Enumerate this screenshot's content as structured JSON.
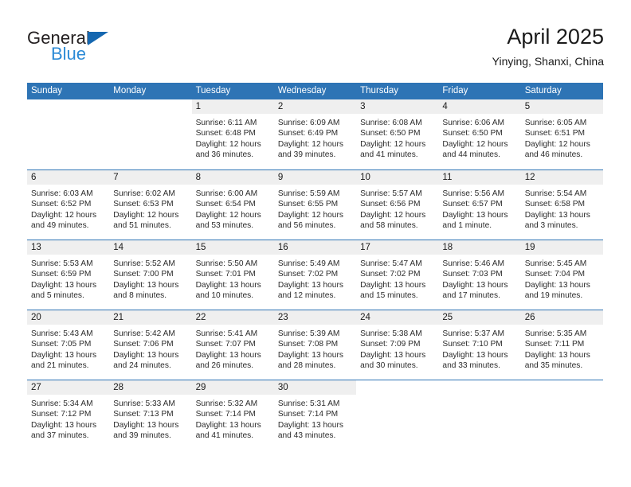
{
  "brand": {
    "name_part1": "General",
    "name_part2": "Blue",
    "color_dark": "#231f20",
    "color_blue": "#2b8ad6",
    "triangle_color": "#1567b0"
  },
  "header": {
    "title": "April 2025",
    "subtitle": "Yinying, Shanxi, China"
  },
  "theme": {
    "header_blue": "#2e74b5",
    "day_band_gray": "#efefef",
    "text_color": "#1a1a1a"
  },
  "weekdays": [
    "Sunday",
    "Monday",
    "Tuesday",
    "Wednesday",
    "Thursday",
    "Friday",
    "Saturday"
  ],
  "weeks": [
    [
      {
        "day": "",
        "sunrise": "",
        "sunset": "",
        "daylight_line1": "",
        "daylight_line2": ""
      },
      {
        "day": "",
        "sunrise": "",
        "sunset": "",
        "daylight_line1": "",
        "daylight_line2": ""
      },
      {
        "day": "1",
        "sunrise": "Sunrise: 6:11 AM",
        "sunset": "Sunset: 6:48 PM",
        "daylight_line1": "Daylight: 12 hours",
        "daylight_line2": "and 36 minutes."
      },
      {
        "day": "2",
        "sunrise": "Sunrise: 6:09 AM",
        "sunset": "Sunset: 6:49 PM",
        "daylight_line1": "Daylight: 12 hours",
        "daylight_line2": "and 39 minutes."
      },
      {
        "day": "3",
        "sunrise": "Sunrise: 6:08 AM",
        "sunset": "Sunset: 6:50 PM",
        "daylight_line1": "Daylight: 12 hours",
        "daylight_line2": "and 41 minutes."
      },
      {
        "day": "4",
        "sunrise": "Sunrise: 6:06 AM",
        "sunset": "Sunset: 6:50 PM",
        "daylight_line1": "Daylight: 12 hours",
        "daylight_line2": "and 44 minutes."
      },
      {
        "day": "5",
        "sunrise": "Sunrise: 6:05 AM",
        "sunset": "Sunset: 6:51 PM",
        "daylight_line1": "Daylight: 12 hours",
        "daylight_line2": "and 46 minutes."
      }
    ],
    [
      {
        "day": "6",
        "sunrise": "Sunrise: 6:03 AM",
        "sunset": "Sunset: 6:52 PM",
        "daylight_line1": "Daylight: 12 hours",
        "daylight_line2": "and 49 minutes."
      },
      {
        "day": "7",
        "sunrise": "Sunrise: 6:02 AM",
        "sunset": "Sunset: 6:53 PM",
        "daylight_line1": "Daylight: 12 hours",
        "daylight_line2": "and 51 minutes."
      },
      {
        "day": "8",
        "sunrise": "Sunrise: 6:00 AM",
        "sunset": "Sunset: 6:54 PM",
        "daylight_line1": "Daylight: 12 hours",
        "daylight_line2": "and 53 minutes."
      },
      {
        "day": "9",
        "sunrise": "Sunrise: 5:59 AM",
        "sunset": "Sunset: 6:55 PM",
        "daylight_line1": "Daylight: 12 hours",
        "daylight_line2": "and 56 minutes."
      },
      {
        "day": "10",
        "sunrise": "Sunrise: 5:57 AM",
        "sunset": "Sunset: 6:56 PM",
        "daylight_line1": "Daylight: 12 hours",
        "daylight_line2": "and 58 minutes."
      },
      {
        "day": "11",
        "sunrise": "Sunrise: 5:56 AM",
        "sunset": "Sunset: 6:57 PM",
        "daylight_line1": "Daylight: 13 hours",
        "daylight_line2": "and 1 minute."
      },
      {
        "day": "12",
        "sunrise": "Sunrise: 5:54 AM",
        "sunset": "Sunset: 6:58 PM",
        "daylight_line1": "Daylight: 13 hours",
        "daylight_line2": "and 3 minutes."
      }
    ],
    [
      {
        "day": "13",
        "sunrise": "Sunrise: 5:53 AM",
        "sunset": "Sunset: 6:59 PM",
        "daylight_line1": "Daylight: 13 hours",
        "daylight_line2": "and 5 minutes."
      },
      {
        "day": "14",
        "sunrise": "Sunrise: 5:52 AM",
        "sunset": "Sunset: 7:00 PM",
        "daylight_line1": "Daylight: 13 hours",
        "daylight_line2": "and 8 minutes."
      },
      {
        "day": "15",
        "sunrise": "Sunrise: 5:50 AM",
        "sunset": "Sunset: 7:01 PM",
        "daylight_line1": "Daylight: 13 hours",
        "daylight_line2": "and 10 minutes."
      },
      {
        "day": "16",
        "sunrise": "Sunrise: 5:49 AM",
        "sunset": "Sunset: 7:02 PM",
        "daylight_line1": "Daylight: 13 hours",
        "daylight_line2": "and 12 minutes."
      },
      {
        "day": "17",
        "sunrise": "Sunrise: 5:47 AM",
        "sunset": "Sunset: 7:02 PM",
        "daylight_line1": "Daylight: 13 hours",
        "daylight_line2": "and 15 minutes."
      },
      {
        "day": "18",
        "sunrise": "Sunrise: 5:46 AM",
        "sunset": "Sunset: 7:03 PM",
        "daylight_line1": "Daylight: 13 hours",
        "daylight_line2": "and 17 minutes."
      },
      {
        "day": "19",
        "sunrise": "Sunrise: 5:45 AM",
        "sunset": "Sunset: 7:04 PM",
        "daylight_line1": "Daylight: 13 hours",
        "daylight_line2": "and 19 minutes."
      }
    ],
    [
      {
        "day": "20",
        "sunrise": "Sunrise: 5:43 AM",
        "sunset": "Sunset: 7:05 PM",
        "daylight_line1": "Daylight: 13 hours",
        "daylight_line2": "and 21 minutes."
      },
      {
        "day": "21",
        "sunrise": "Sunrise: 5:42 AM",
        "sunset": "Sunset: 7:06 PM",
        "daylight_line1": "Daylight: 13 hours",
        "daylight_line2": "and 24 minutes."
      },
      {
        "day": "22",
        "sunrise": "Sunrise: 5:41 AM",
        "sunset": "Sunset: 7:07 PM",
        "daylight_line1": "Daylight: 13 hours",
        "daylight_line2": "and 26 minutes."
      },
      {
        "day": "23",
        "sunrise": "Sunrise: 5:39 AM",
        "sunset": "Sunset: 7:08 PM",
        "daylight_line1": "Daylight: 13 hours",
        "daylight_line2": "and 28 minutes."
      },
      {
        "day": "24",
        "sunrise": "Sunrise: 5:38 AM",
        "sunset": "Sunset: 7:09 PM",
        "daylight_line1": "Daylight: 13 hours",
        "daylight_line2": "and 30 minutes."
      },
      {
        "day": "25",
        "sunrise": "Sunrise: 5:37 AM",
        "sunset": "Sunset: 7:10 PM",
        "daylight_line1": "Daylight: 13 hours",
        "daylight_line2": "and 33 minutes."
      },
      {
        "day": "26",
        "sunrise": "Sunrise: 5:35 AM",
        "sunset": "Sunset: 7:11 PM",
        "daylight_line1": "Daylight: 13 hours",
        "daylight_line2": "and 35 minutes."
      }
    ],
    [
      {
        "day": "27",
        "sunrise": "Sunrise: 5:34 AM",
        "sunset": "Sunset: 7:12 PM",
        "daylight_line1": "Daylight: 13 hours",
        "daylight_line2": "and 37 minutes."
      },
      {
        "day": "28",
        "sunrise": "Sunrise: 5:33 AM",
        "sunset": "Sunset: 7:13 PM",
        "daylight_line1": "Daylight: 13 hours",
        "daylight_line2": "and 39 minutes."
      },
      {
        "day": "29",
        "sunrise": "Sunrise: 5:32 AM",
        "sunset": "Sunset: 7:14 PM",
        "daylight_line1": "Daylight: 13 hours",
        "daylight_line2": "and 41 minutes."
      },
      {
        "day": "30",
        "sunrise": "Sunrise: 5:31 AM",
        "sunset": "Sunset: 7:14 PM",
        "daylight_line1": "Daylight: 13 hours",
        "daylight_line2": "and 43 minutes."
      },
      {
        "day": "",
        "sunrise": "",
        "sunset": "",
        "daylight_line1": "",
        "daylight_line2": ""
      },
      {
        "day": "",
        "sunrise": "",
        "sunset": "",
        "daylight_line1": "",
        "daylight_line2": ""
      },
      {
        "day": "",
        "sunrise": "",
        "sunset": "",
        "daylight_line1": "",
        "daylight_line2": ""
      }
    ]
  ]
}
